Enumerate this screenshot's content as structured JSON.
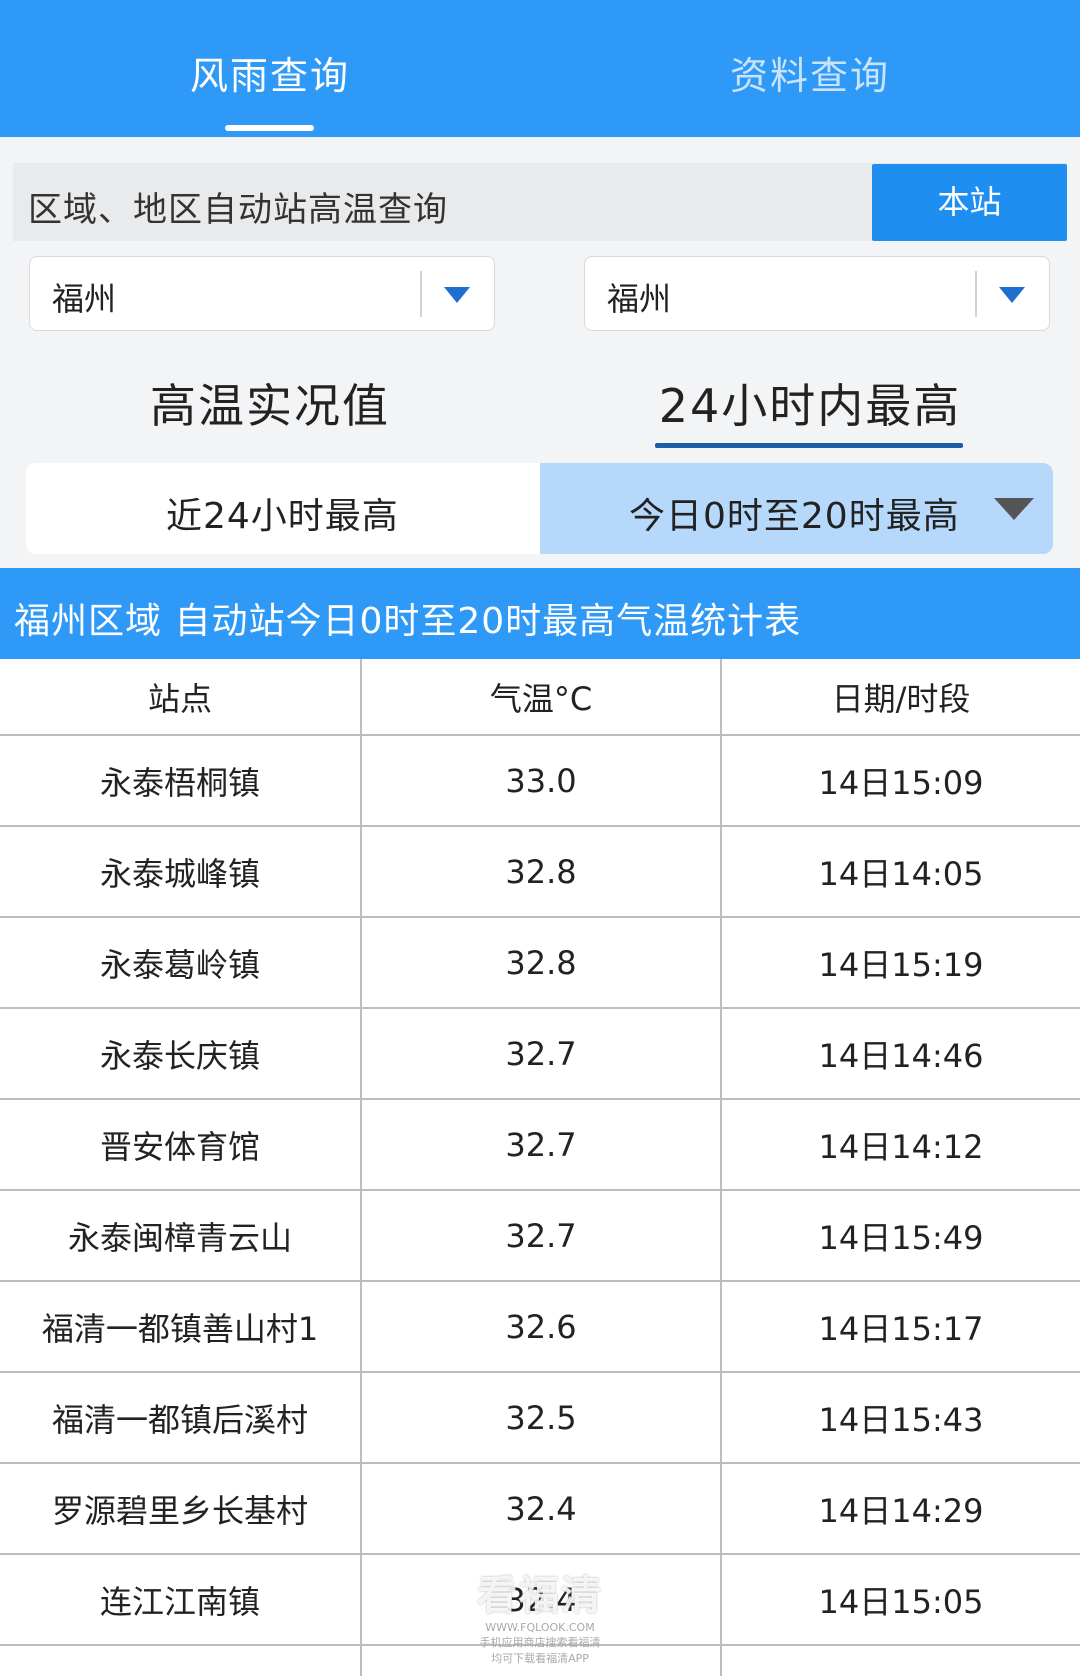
{
  "top_tabs": [
    "风雨查询",
    "资料查询"
  ],
  "query": {
    "label": "区域、地区自动站高温查询",
    "station_button": "本站"
  },
  "selects": [
    {
      "value": "福州",
      "icon": "triangle-down-icon"
    },
    {
      "value": "福州",
      "icon": "triangle-down-icon"
    }
  ],
  "sub_tabs": [
    "高温实况值",
    "24小时内最高"
  ],
  "segment": {
    "left": "近24小时最高",
    "right": "今日0时至20时最高"
  },
  "banner": "福州区域 自动站今日0时至20时最高气温统计表",
  "table": {
    "headers": [
      "站点",
      "气温°C",
      "日期/时段"
    ],
    "rows": [
      [
        "永泰梧桐镇",
        "33.0",
        "14日15:09"
      ],
      [
        "永泰城峰镇",
        "32.8",
        "14日14:05"
      ],
      [
        "永泰葛岭镇",
        "32.8",
        "14日15:19"
      ],
      [
        "永泰长庆镇",
        "32.7",
        "14日14:46"
      ],
      [
        "晋安体育馆",
        "32.7",
        "14日14:12"
      ],
      [
        "永泰闽樟青云山",
        "32.7",
        "14日15:49"
      ],
      [
        "福清一都镇善山村1",
        "32.6",
        "14日15:17"
      ],
      [
        "福清一都镇后溪村",
        "32.5",
        "14日15:43"
      ],
      [
        "罗源碧里乡长基村",
        "32.4",
        "14日14:29"
      ],
      [
        "连江江南镇",
        "32.4",
        "14日15:05"
      ]
    ]
  },
  "watermark": {
    "title": "看福清",
    "url": "WWW.FQLOOK.COM",
    "line1": "手机应用商店搜索看福清",
    "line2": "均可下载看福清APP"
  },
  "colors": {
    "primary": "#2e99f6",
    "button": "#1e8ef0",
    "segment_active": "#b6d9fb",
    "underline": "#1f5ca8"
  }
}
